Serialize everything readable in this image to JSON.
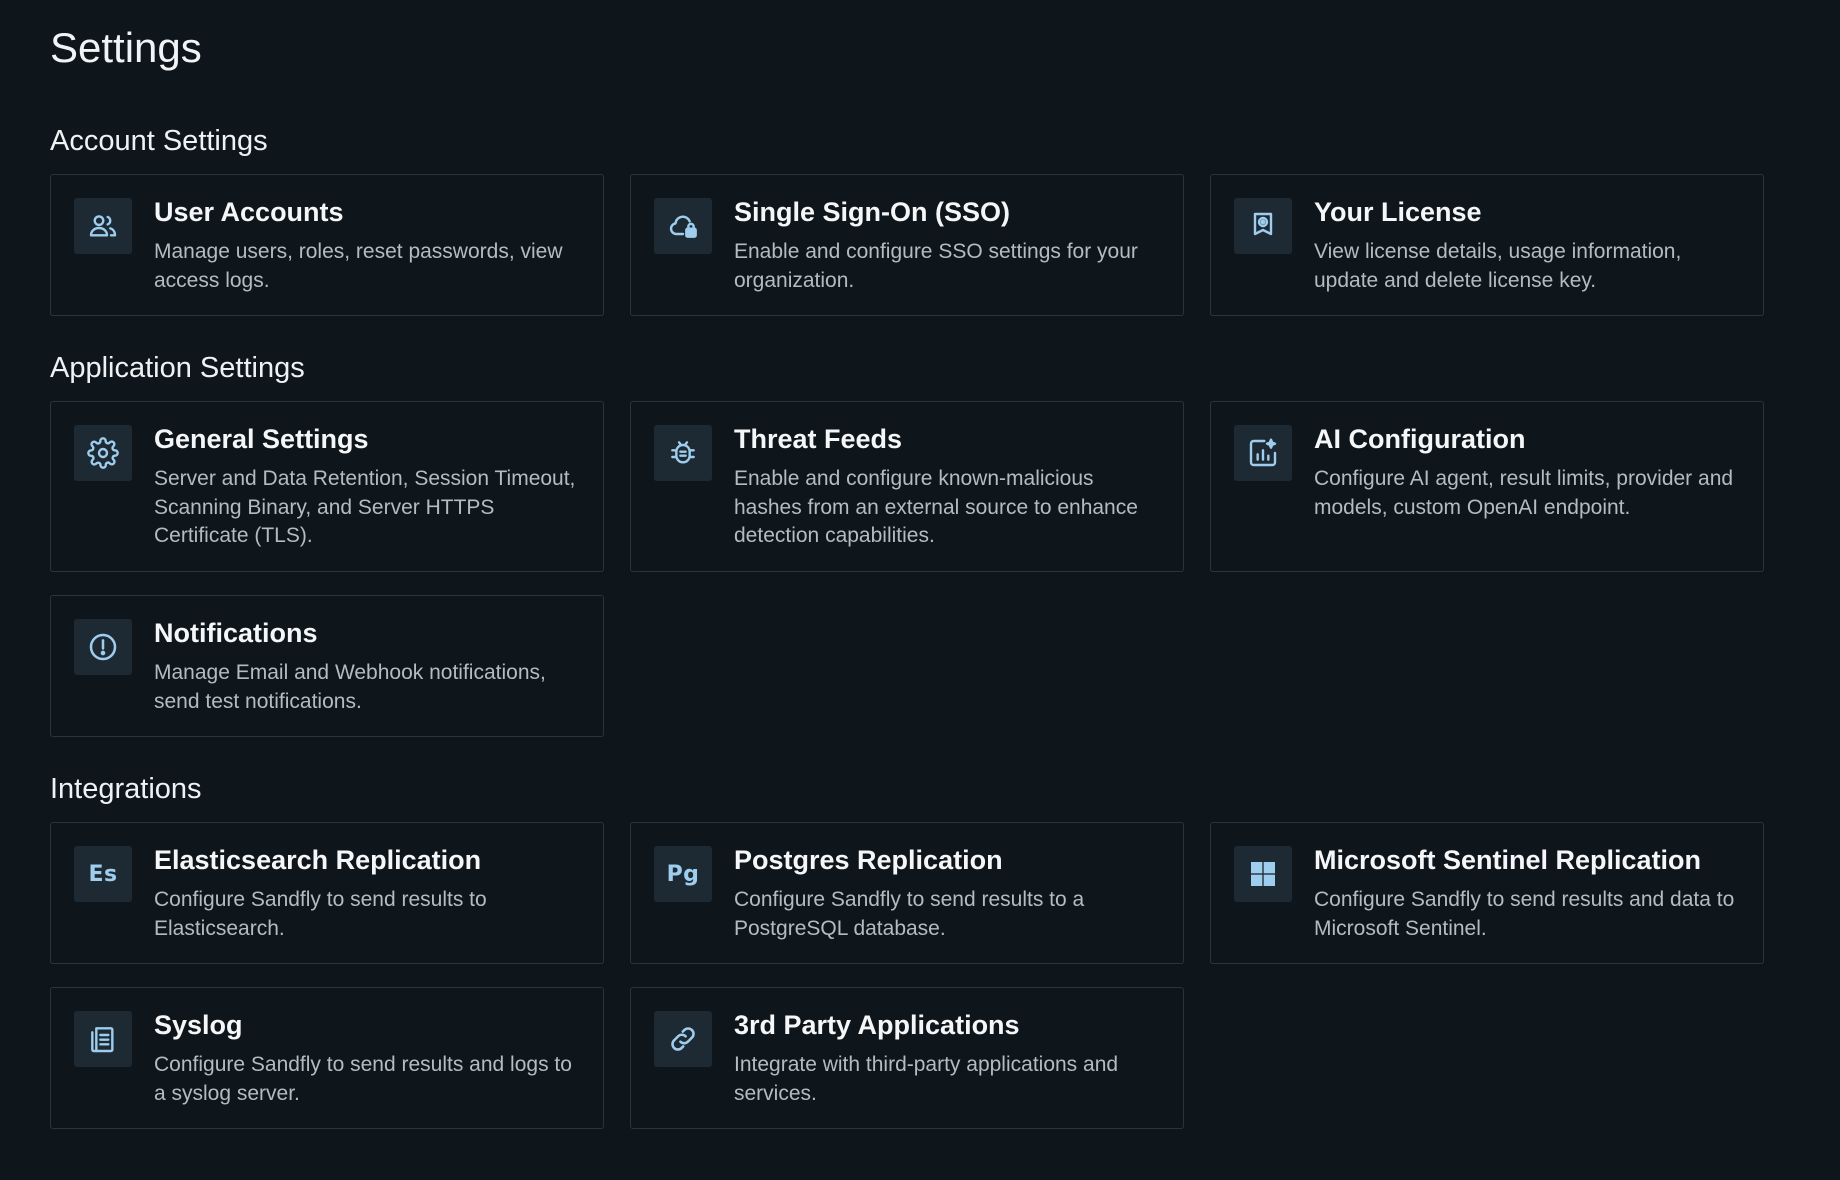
{
  "page": {
    "title": "Settings"
  },
  "sections": {
    "account": {
      "title": "Account Settings",
      "cards": {
        "user_accounts": {
          "title": "User Accounts",
          "description": "Manage users, roles, reset passwords, view access logs.",
          "icon": "users-icon"
        },
        "sso": {
          "title": "Single Sign-On (SSO)",
          "description": "Enable and configure SSO settings for your organization.",
          "icon": "cloud-lock-icon"
        },
        "license": {
          "title": "Your License",
          "description": "View license details, usage information, update and delete license key.",
          "icon": "award-badge-icon"
        }
      }
    },
    "application": {
      "title": "Application Settings",
      "cards": {
        "general": {
          "title": "General Settings",
          "description": "Server and Data Retention, Session Timeout, Scanning Binary, and Server HTTPS Certificate (TLS).",
          "icon": "gear-icon"
        },
        "threat_feeds": {
          "title": "Threat Feeds",
          "description": "Enable and configure known-malicious hashes from an external source to enhance detection capabilities.",
          "icon": "bug-icon"
        },
        "ai_config": {
          "title": "AI Configuration",
          "description": "Configure AI agent, result limits, provider and models, custom OpenAI endpoint.",
          "icon": "chart-sparkle-icon"
        },
        "notifications": {
          "title": "Notifications",
          "description": "Manage Email and Webhook notifications, send test notifications.",
          "icon": "alert-circle-icon"
        }
      }
    },
    "integrations": {
      "title": "Integrations",
      "cards": {
        "elasticsearch": {
          "title": "Elasticsearch Replication",
          "description": "Configure Sandfly to send results to Elasticsearch.",
          "icon": "elasticsearch-icon",
          "icon_text": "Es"
        },
        "postgres": {
          "title": "Postgres Replication",
          "description": "Configure Sandfly to send results to a PostgreSQL database.",
          "icon": "postgres-icon",
          "icon_text": "Pg"
        },
        "sentinel": {
          "title": "Microsoft Sentinel Replication",
          "description": "Configure Sandfly to send results and data to Microsoft Sentinel.",
          "icon": "windows-icon"
        },
        "syslog": {
          "title": "Syslog",
          "description": "Configure Sandfly to send results and logs to a syslog server.",
          "icon": "document-icon"
        },
        "third_party": {
          "title": "3rd Party Applications",
          "description": "Integrate with third-party applications and services.",
          "icon": "link-icon"
        }
      }
    }
  },
  "colors": {
    "background": "#0f161b",
    "card_border": "#2a343b",
    "icon_bg": "#1d2a33",
    "icon_accent": "#9fcdee"
  }
}
